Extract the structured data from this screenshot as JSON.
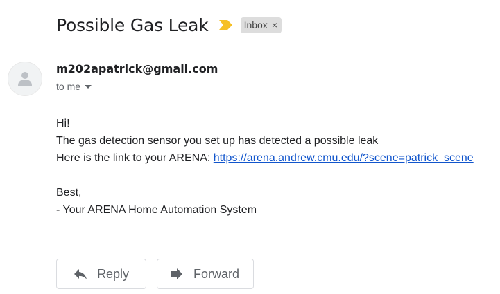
{
  "subject": "Possible Gas Leak",
  "importance_icon": "importance-marker-icon",
  "importance_color": "#f6c026",
  "label_chip": {
    "label": "Inbox",
    "close_glyph": "×"
  },
  "sender": {
    "email": "m202apatrick@gmail.com",
    "recipient_text": "to me"
  },
  "message": {
    "greeting": "Hi!",
    "line1": "The gas detection sensor you set up has detected a possible leak",
    "line2_prefix": "Here is the link to your ARENA: ",
    "link_text": "https://arena.andrew.cmu.edu/?scene=patrick_scene",
    "signoff": "Best,",
    "signature": "- Your ARENA Home Automation System"
  },
  "actions": {
    "reply_label": "Reply",
    "forward_label": "Forward"
  },
  "colors": {
    "link": "#1155cc",
    "text": "#202124",
    "muted": "#5f6368"
  }
}
